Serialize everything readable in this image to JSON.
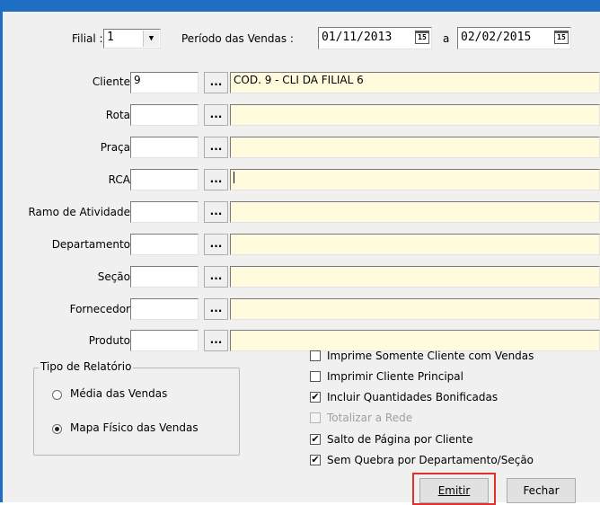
{
  "filter": {
    "filial_label": "Filial :",
    "filial_value": "1",
    "periodo_label": "Período das Vendas :",
    "date_from": "01/11/2013",
    "date_sep": "a",
    "date_to": "02/02/2015"
  },
  "fields": {
    "cliente": {
      "label": "Cliente",
      "code": "9",
      "desc": "COD. 9 - CLI DA FILIAL 6"
    },
    "rota": {
      "label": "Rota",
      "code": "",
      "desc": ""
    },
    "praca": {
      "label": "Praça",
      "code": "",
      "desc": ""
    },
    "rca": {
      "label": "RCA",
      "code": "",
      "desc": ""
    },
    "ramo": {
      "label": "Ramo de Atividade",
      "code": "",
      "desc": ""
    },
    "departamento": {
      "label": "Departamento",
      "code": "",
      "desc": ""
    },
    "secao": {
      "label": "Seção",
      "code": "",
      "desc": ""
    },
    "fornecedor": {
      "label": "Fornecedor",
      "code": "",
      "desc": ""
    },
    "produto": {
      "label": "Produto",
      "code": "",
      "desc": ""
    }
  },
  "search_button_label": "...",
  "report_type": {
    "title": "Tipo de Relatório",
    "option1": "Média das Vendas",
    "option2": "Mapa Físico das Vendas",
    "selected": "Mapa Físico das Vendas"
  },
  "options": {
    "opt1": {
      "label": "Imprime Somente Cliente com Vendas",
      "checked": false
    },
    "opt2": {
      "label": "Imprimir Cliente Principal",
      "checked": false
    },
    "opt3": {
      "label": "Incluir Quantidades Bonificadas",
      "checked": true
    },
    "opt4": {
      "label": "Totalizar a Rede",
      "checked": false,
      "disabled": true
    },
    "opt5": {
      "label": "Salto de Página por Cliente",
      "checked": true
    },
    "opt6": {
      "label": "Sem Quebra por Departamento/Seção",
      "checked": true
    }
  },
  "buttons": {
    "emitir": "Emitir",
    "fechar": "Fechar"
  },
  "icons": {
    "calendar": "15",
    "check_mark": "✔",
    "dropdown": "▼"
  },
  "colors": {
    "frame": "#1e6fc4",
    "highlight": "#e03030",
    "field_yellow": "#fffbdc"
  }
}
